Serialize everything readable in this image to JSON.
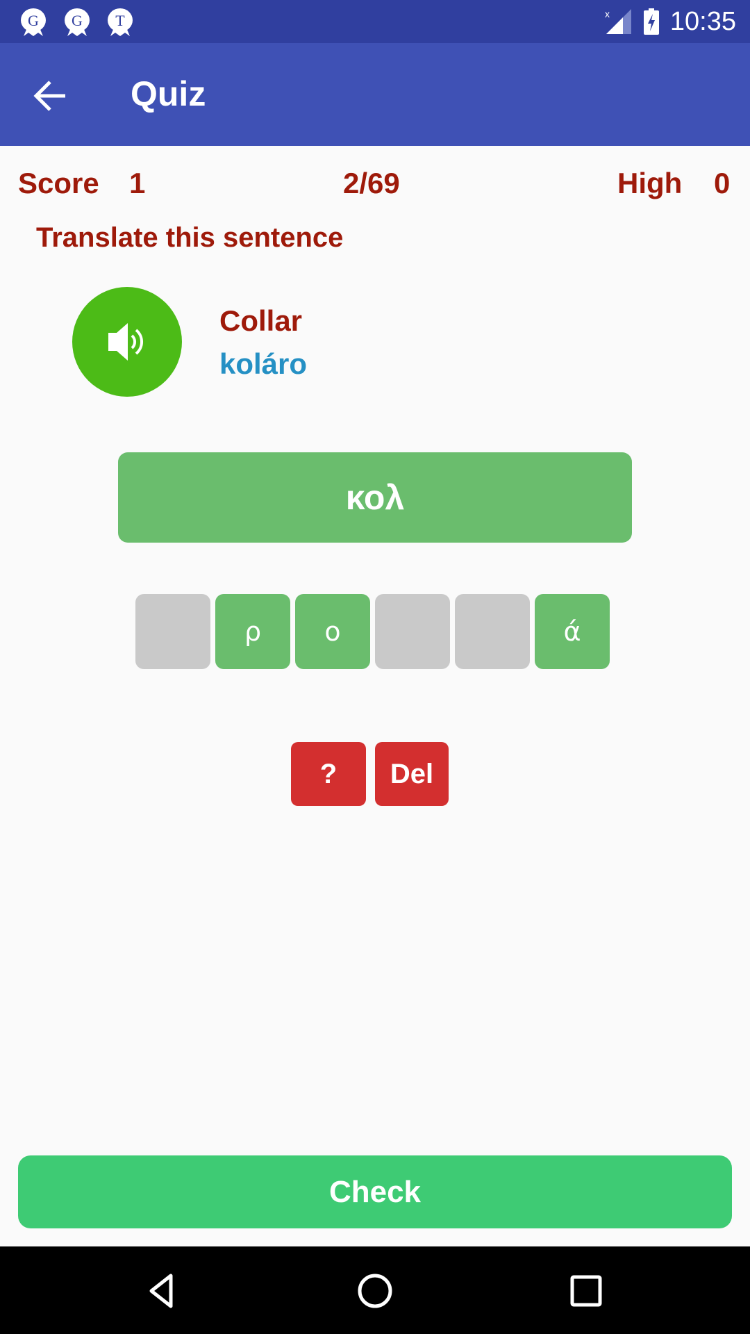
{
  "status_bar": {
    "notifications": [
      {
        "icon": "notification-app-icon",
        "letter": "G"
      },
      {
        "icon": "notification-app-icon",
        "letter": "G"
      },
      {
        "icon": "notification-app-icon",
        "letter": "T"
      }
    ],
    "signal_icon": "signal-no-service-icon",
    "battery_icon": "battery-charging-icon",
    "time": "10:35"
  },
  "app_bar": {
    "back_icon": "arrow-back-icon",
    "title": "Quiz"
  },
  "score_row": {
    "score_label": "Score",
    "score_value": "1",
    "progress": "2/69",
    "high_label": "High",
    "high_value": "0"
  },
  "instruction": "Translate this sentence",
  "prompt": {
    "speaker_icon": "volume-up-icon",
    "word": "Collar",
    "transliteration": "koláro"
  },
  "answer": {
    "current_text": "κολ"
  },
  "letter_tiles": [
    {
      "letter": "",
      "state": "used"
    },
    {
      "letter": "ρ",
      "state": "available"
    },
    {
      "letter": "ο",
      "state": "available"
    },
    {
      "letter": "",
      "state": "used"
    },
    {
      "letter": "",
      "state": "used"
    },
    {
      "letter": "ά",
      "state": "available"
    }
  ],
  "actions": {
    "hint_label": "?",
    "delete_label": "Del"
  },
  "check_label": "Check",
  "colors": {
    "status_bar": "#303f9f",
    "app_bar": "#3f51b5",
    "text_red": "#9e1a0a",
    "transliteration_blue": "#2590c4",
    "speaker_green": "#4cbb17",
    "tile_green": "#6abd6d",
    "tile_gray": "#c9c9c9",
    "action_red": "#d32f2f",
    "check_green": "#3ecb74"
  },
  "nav_bar": {
    "back": "nav-back-icon",
    "home": "nav-home-icon",
    "recents": "nav-recents-icon"
  }
}
